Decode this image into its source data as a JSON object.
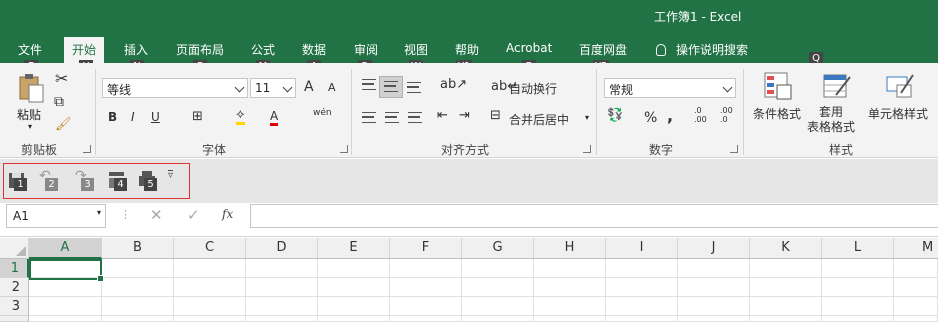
{
  "title": "工作簿1  -  Excel",
  "tabs": [
    "文件",
    "开始",
    "插入",
    "页面布局",
    "公式",
    "数据",
    "审阅",
    "视图",
    "帮助",
    "Acrobat",
    "百度网盘"
  ],
  "tell_me": "操作说明搜索",
  "keytips": {
    "file": "F",
    "home": "H",
    "insert": "N",
    "layout": "P",
    "formulas": "M",
    "data": "A",
    "review": "R",
    "view": "W",
    "help": "Y1",
    "acrobat": "B",
    "baidu": "Y2",
    "tell": "Q"
  },
  "clipboard": {
    "paste": "粘贴",
    "group": "剪贴板"
  },
  "font": {
    "name": "等线",
    "size": "11",
    "group": "字体",
    "bold": "B",
    "italic": "I",
    "underline": "U",
    "grow": "A",
    "shrink": "A",
    "font_color": "A",
    "phonetic": "wén"
  },
  "alignment": {
    "wrap": "自动换行",
    "merge": "合并后居中",
    "group": "对齐方式"
  },
  "number": {
    "format": "常规",
    "group": "数字",
    "percent": "%",
    "comma": ",",
    "inc_dec": ".0\n.00",
    "dec_dec": ".00\n.0"
  },
  "styles": {
    "cond": "条件格式",
    "table": "套用\n表格格式",
    "cell": "单元格样式",
    "group": "样式"
  },
  "qat": [
    "1",
    "2",
    "3",
    "4",
    "5"
  ],
  "namebox": "A1",
  "fx": "fx",
  "columns": [
    "A",
    "B",
    "C",
    "D",
    "E",
    "F",
    "G",
    "H",
    "I",
    "J",
    "K",
    "L",
    "M"
  ],
  "rows": [
    "1",
    "2",
    "3"
  ]
}
